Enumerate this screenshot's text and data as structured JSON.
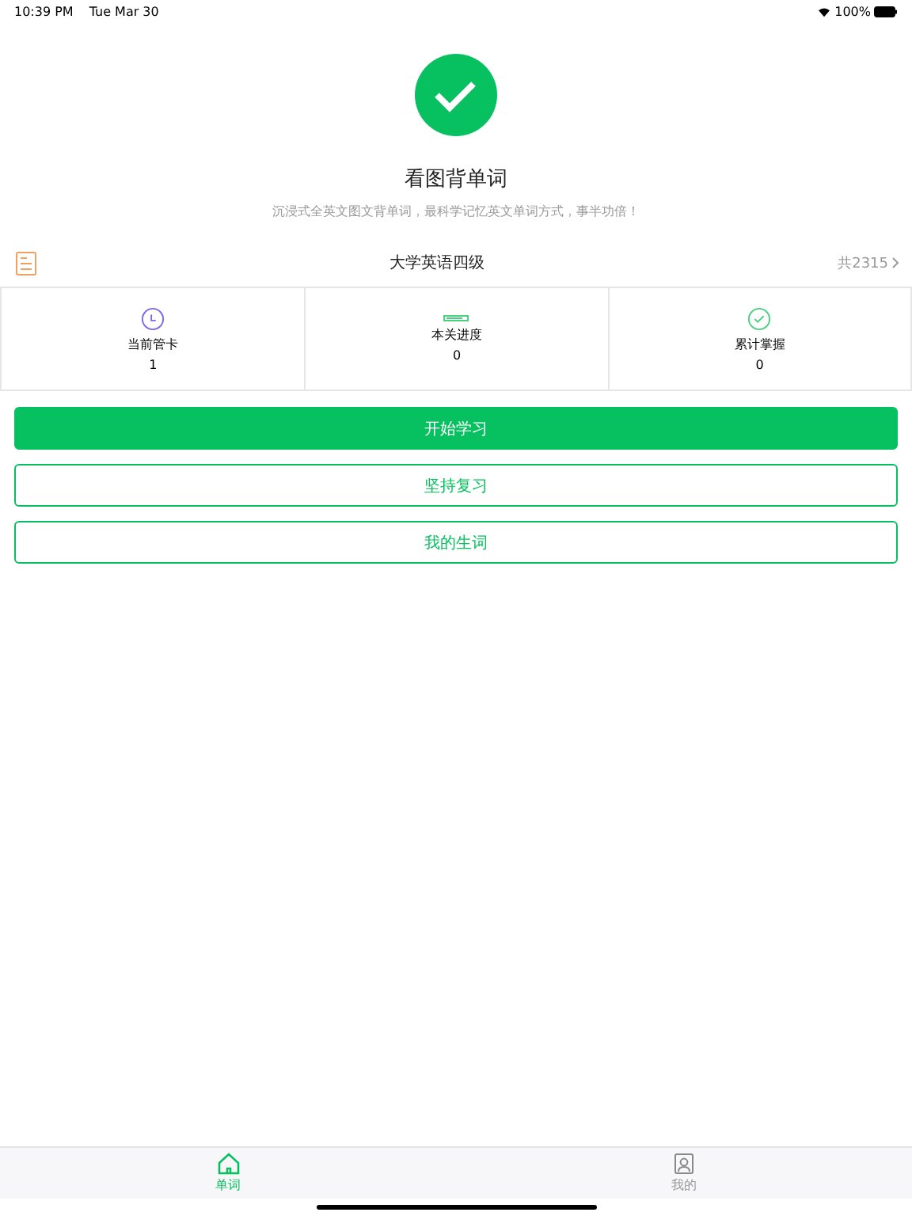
{
  "status_bar": {
    "time": "10:39 PM",
    "date": "Tue Mar 30",
    "battery": "100%"
  },
  "hero": {
    "title": "看图背单词",
    "subtitle": "沉浸式全英文图文背单词，最科学记忆英文单词方式，事半功倍！"
  },
  "book": {
    "name": "大学英语四级",
    "count": "共2315"
  },
  "stats": [
    {
      "kind": "clock",
      "label": "当前管卡",
      "value": "1"
    },
    {
      "kind": "progress",
      "label": "本关进度",
      "value": "0"
    },
    {
      "kind": "check",
      "label": "累计掌握",
      "value": "0"
    }
  ],
  "buttons": [
    {
      "kind": "primary",
      "label": "开始学习"
    },
    {
      "kind": "outline",
      "label": "坚持复习"
    },
    {
      "kind": "outline",
      "label": "我的生词"
    }
  ],
  "tabs": [
    {
      "kind": "home",
      "label": "单词",
      "selected": true
    },
    {
      "kind": "profile",
      "label": "我的",
      "selected": false
    }
  ]
}
